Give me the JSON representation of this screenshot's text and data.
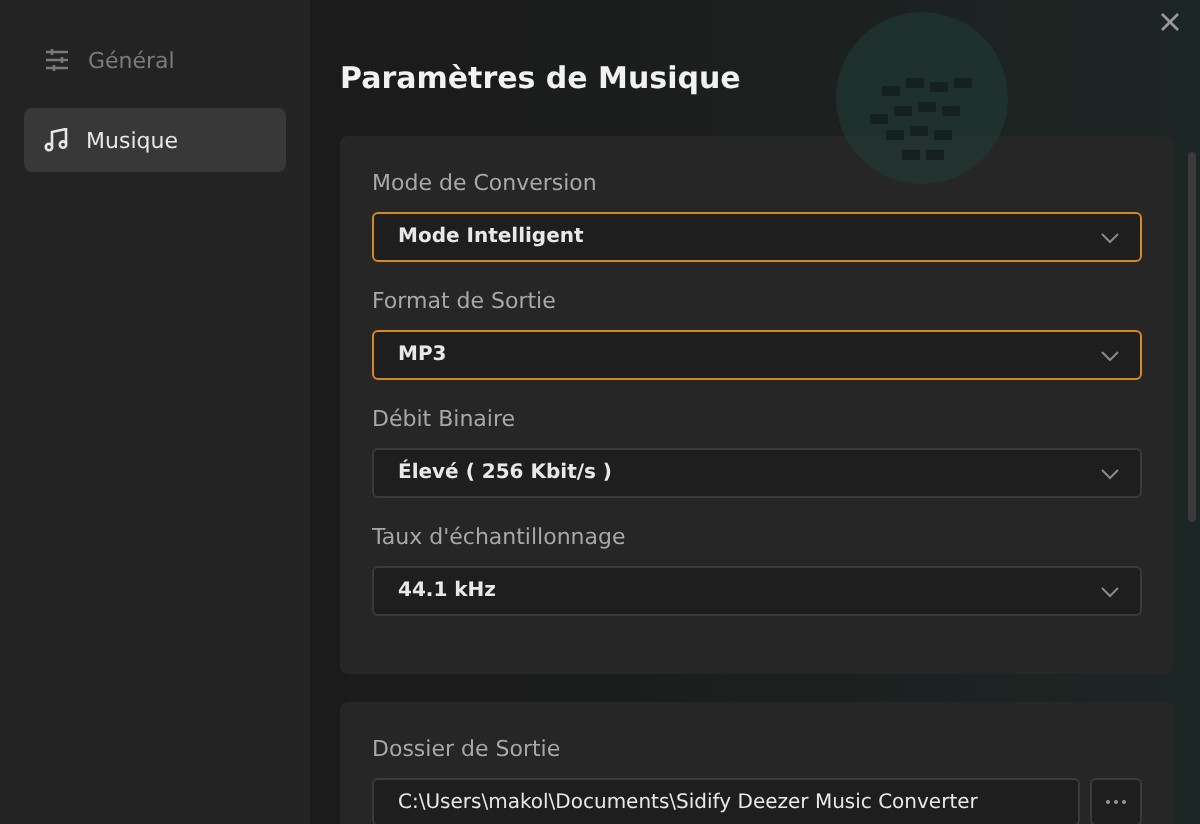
{
  "sidebar": {
    "items": [
      {
        "label": "Général",
        "kind": "general",
        "selected": false
      },
      {
        "label": "Musique",
        "kind": "music",
        "selected": true
      }
    ]
  },
  "title": "Paramètres de Musique",
  "settings": [
    {
      "label": "Mode de Conversion",
      "value": "Mode Intelligent",
      "focused": true
    },
    {
      "label": "Format de Sortie",
      "value": "MP3",
      "focused": true
    },
    {
      "label": "Débit Binaire",
      "value": "Élevé ( 256 Kbit/s )",
      "focused": false
    },
    {
      "label": "Taux d'échantillonnage",
      "value": "44.1 kHz",
      "focused": false
    }
  ],
  "output": {
    "label": "Dossier de Sortie",
    "value": "C:\\Users\\makol\\Documents\\Sidify Deezer Music Converter"
  }
}
